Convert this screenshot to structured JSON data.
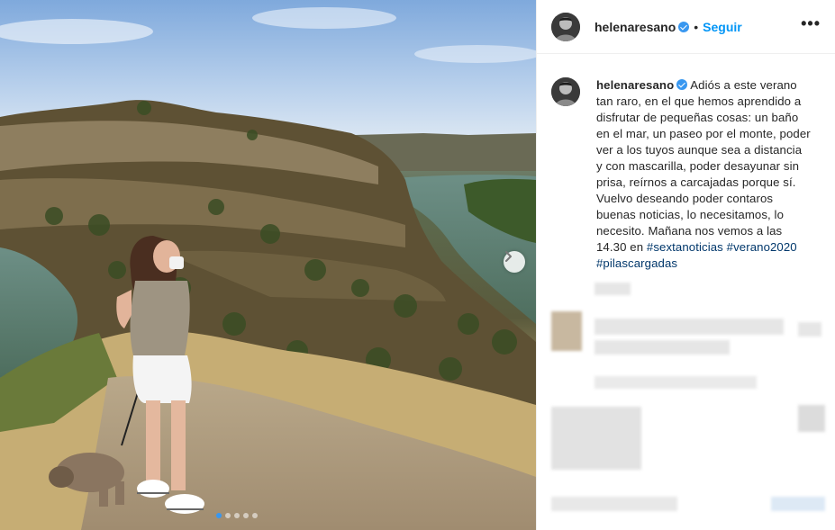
{
  "post": {
    "username": "helenaresano",
    "verified": true,
    "separator": "•",
    "follow_label": "Seguir",
    "more_label": "•••",
    "caption_text": "Adiós a este verano tan raro, en el que hemos aprendido a disfrutar de pequeñas cosas: un baño en el mar, un paseo por el monte, poder ver a los tuyos aunque sea a distancia y con mascarilla, poder desayunar sin prisa, reírnos a carcajadas porque sí. Vuelvo deseando poder contaros buenas noticias, lo necesitamos, lo necesito. Mañana nos vemos a las 14.30 en",
    "hashtags": [
      "#sextanoticias",
      "#verano2020",
      "#pilascargadas"
    ]
  },
  "carousel": {
    "next_icon": "chevron-right-icon",
    "current_slide": 1,
    "slide_count": 5
  },
  "colors": {
    "accent": "#0095f6",
    "verified": "#3897f0",
    "hashtag": "#00376b"
  }
}
